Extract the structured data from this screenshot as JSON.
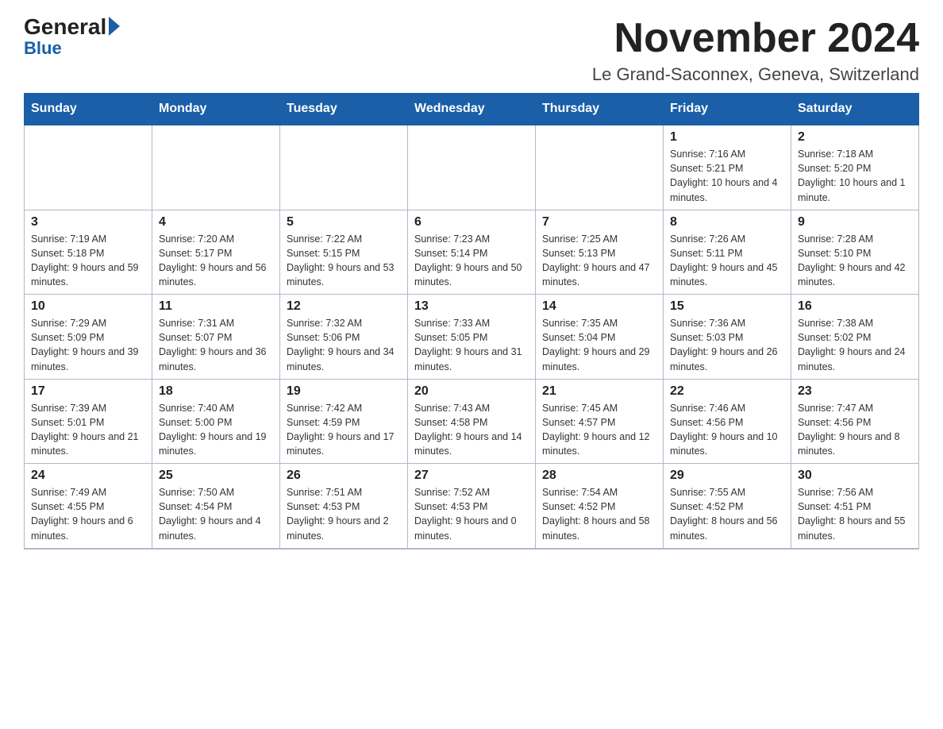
{
  "logo": {
    "general": "General",
    "blue": "Blue"
  },
  "title": "November 2024",
  "location": "Le Grand-Saconnex, Geneva, Switzerland",
  "weekdays": [
    "Sunday",
    "Monday",
    "Tuesday",
    "Wednesday",
    "Thursday",
    "Friday",
    "Saturday"
  ],
  "weeks": [
    [
      {
        "day": "",
        "info": ""
      },
      {
        "day": "",
        "info": ""
      },
      {
        "day": "",
        "info": ""
      },
      {
        "day": "",
        "info": ""
      },
      {
        "day": "",
        "info": ""
      },
      {
        "day": "1",
        "info": "Sunrise: 7:16 AM\nSunset: 5:21 PM\nDaylight: 10 hours and 4 minutes."
      },
      {
        "day": "2",
        "info": "Sunrise: 7:18 AM\nSunset: 5:20 PM\nDaylight: 10 hours and 1 minute."
      }
    ],
    [
      {
        "day": "3",
        "info": "Sunrise: 7:19 AM\nSunset: 5:18 PM\nDaylight: 9 hours and 59 minutes."
      },
      {
        "day": "4",
        "info": "Sunrise: 7:20 AM\nSunset: 5:17 PM\nDaylight: 9 hours and 56 minutes."
      },
      {
        "day": "5",
        "info": "Sunrise: 7:22 AM\nSunset: 5:15 PM\nDaylight: 9 hours and 53 minutes."
      },
      {
        "day": "6",
        "info": "Sunrise: 7:23 AM\nSunset: 5:14 PM\nDaylight: 9 hours and 50 minutes."
      },
      {
        "day": "7",
        "info": "Sunrise: 7:25 AM\nSunset: 5:13 PM\nDaylight: 9 hours and 47 minutes."
      },
      {
        "day": "8",
        "info": "Sunrise: 7:26 AM\nSunset: 5:11 PM\nDaylight: 9 hours and 45 minutes."
      },
      {
        "day": "9",
        "info": "Sunrise: 7:28 AM\nSunset: 5:10 PM\nDaylight: 9 hours and 42 minutes."
      }
    ],
    [
      {
        "day": "10",
        "info": "Sunrise: 7:29 AM\nSunset: 5:09 PM\nDaylight: 9 hours and 39 minutes."
      },
      {
        "day": "11",
        "info": "Sunrise: 7:31 AM\nSunset: 5:07 PM\nDaylight: 9 hours and 36 minutes."
      },
      {
        "day": "12",
        "info": "Sunrise: 7:32 AM\nSunset: 5:06 PM\nDaylight: 9 hours and 34 minutes."
      },
      {
        "day": "13",
        "info": "Sunrise: 7:33 AM\nSunset: 5:05 PM\nDaylight: 9 hours and 31 minutes."
      },
      {
        "day": "14",
        "info": "Sunrise: 7:35 AM\nSunset: 5:04 PM\nDaylight: 9 hours and 29 minutes."
      },
      {
        "day": "15",
        "info": "Sunrise: 7:36 AM\nSunset: 5:03 PM\nDaylight: 9 hours and 26 minutes."
      },
      {
        "day": "16",
        "info": "Sunrise: 7:38 AM\nSunset: 5:02 PM\nDaylight: 9 hours and 24 minutes."
      }
    ],
    [
      {
        "day": "17",
        "info": "Sunrise: 7:39 AM\nSunset: 5:01 PM\nDaylight: 9 hours and 21 minutes."
      },
      {
        "day": "18",
        "info": "Sunrise: 7:40 AM\nSunset: 5:00 PM\nDaylight: 9 hours and 19 minutes."
      },
      {
        "day": "19",
        "info": "Sunrise: 7:42 AM\nSunset: 4:59 PM\nDaylight: 9 hours and 17 minutes."
      },
      {
        "day": "20",
        "info": "Sunrise: 7:43 AM\nSunset: 4:58 PM\nDaylight: 9 hours and 14 minutes."
      },
      {
        "day": "21",
        "info": "Sunrise: 7:45 AM\nSunset: 4:57 PM\nDaylight: 9 hours and 12 minutes."
      },
      {
        "day": "22",
        "info": "Sunrise: 7:46 AM\nSunset: 4:56 PM\nDaylight: 9 hours and 10 minutes."
      },
      {
        "day": "23",
        "info": "Sunrise: 7:47 AM\nSunset: 4:56 PM\nDaylight: 9 hours and 8 minutes."
      }
    ],
    [
      {
        "day": "24",
        "info": "Sunrise: 7:49 AM\nSunset: 4:55 PM\nDaylight: 9 hours and 6 minutes."
      },
      {
        "day": "25",
        "info": "Sunrise: 7:50 AM\nSunset: 4:54 PM\nDaylight: 9 hours and 4 minutes."
      },
      {
        "day": "26",
        "info": "Sunrise: 7:51 AM\nSunset: 4:53 PM\nDaylight: 9 hours and 2 minutes."
      },
      {
        "day": "27",
        "info": "Sunrise: 7:52 AM\nSunset: 4:53 PM\nDaylight: 9 hours and 0 minutes."
      },
      {
        "day": "28",
        "info": "Sunrise: 7:54 AM\nSunset: 4:52 PM\nDaylight: 8 hours and 58 minutes."
      },
      {
        "day": "29",
        "info": "Sunrise: 7:55 AM\nSunset: 4:52 PM\nDaylight: 8 hours and 56 minutes."
      },
      {
        "day": "30",
        "info": "Sunrise: 7:56 AM\nSunset: 4:51 PM\nDaylight: 8 hours and 55 minutes."
      }
    ]
  ]
}
